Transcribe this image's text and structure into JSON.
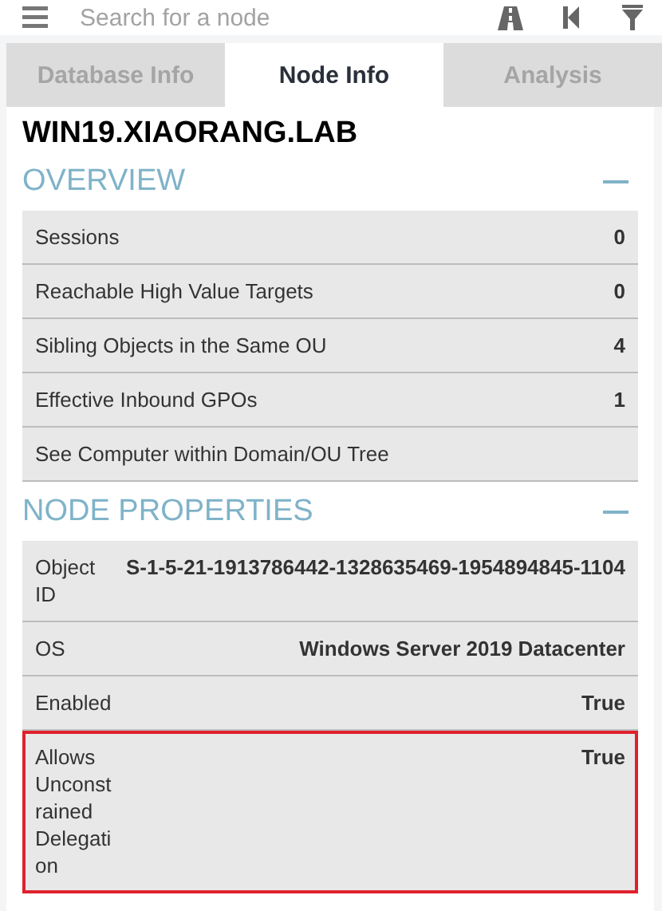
{
  "search": {
    "placeholder": "Search for a node"
  },
  "tabs": [
    {
      "label": "Database Info",
      "selected": false
    },
    {
      "label": "Node Info",
      "selected": true
    },
    {
      "label": "Analysis",
      "selected": false
    }
  ],
  "node": {
    "title": "WIN19.XIAORANG.LAB"
  },
  "sections": [
    {
      "title": "OVERVIEW",
      "expanded": true,
      "kind": "overview",
      "rows": [
        {
          "label": "Sessions",
          "value": "0"
        },
        {
          "label": "Reachable High Value Targets",
          "value": "0"
        },
        {
          "label": "Sibling Objects in the Same OU",
          "value": "4"
        },
        {
          "label": "Effective Inbound GPOs",
          "value": "1"
        },
        {
          "label": "See Computer within Domain/OU Tree"
        }
      ]
    },
    {
      "title": "NODE PROPERTIES",
      "expanded": true,
      "kind": "properties",
      "rows": [
        {
          "label": "Object ID",
          "value": "S-1-5-21-1913786442-1328635469-1954894845-1104",
          "highlighted": false
        },
        {
          "label": "OS",
          "value": "Windows Server 2019 Datacenter",
          "highlighted": false
        },
        {
          "label": "Enabled",
          "value": "True",
          "highlighted": false
        },
        {
          "label": "Allows Unconstrained Delegation",
          "value": "True",
          "highlighted": true
        }
      ]
    }
  ]
}
